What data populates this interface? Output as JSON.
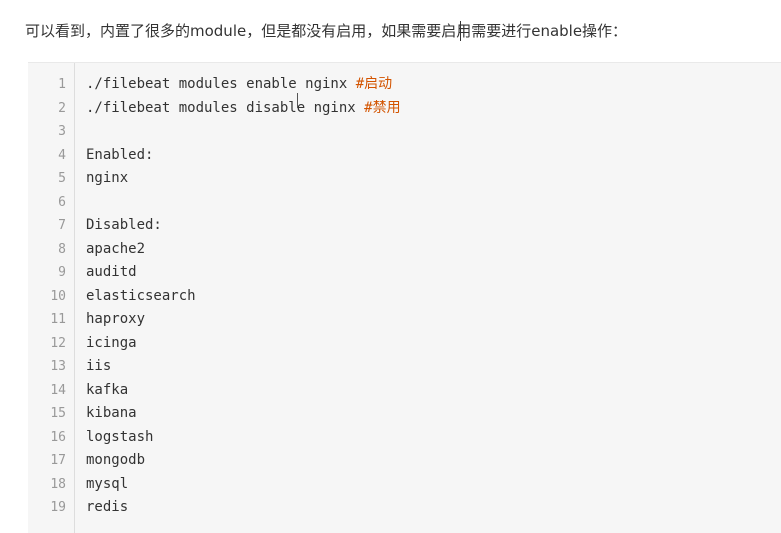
{
  "intro_text": "可以看到，内置了很多的module，但是都没有启用，如果需要启用需要进行enable操作：",
  "code": {
    "lines": [
      {
        "num": "1",
        "text": "./filebeat modules enable nginx ",
        "comment": "#启动"
      },
      {
        "num": "2",
        "text": "./filebeat modules disable nginx ",
        "comment": "#禁用"
      },
      {
        "num": "3",
        "text": "",
        "comment": ""
      },
      {
        "num": "4",
        "text": "Enabled:",
        "comment": ""
      },
      {
        "num": "5",
        "text": "nginx",
        "comment": ""
      },
      {
        "num": "6",
        "text": "",
        "comment": ""
      },
      {
        "num": "7",
        "text": "Disabled:",
        "comment": ""
      },
      {
        "num": "8",
        "text": "apache2",
        "comment": ""
      },
      {
        "num": "9",
        "text": "auditd",
        "comment": ""
      },
      {
        "num": "10",
        "text": "elasticsearch",
        "comment": ""
      },
      {
        "num": "11",
        "text": "haproxy",
        "comment": ""
      },
      {
        "num": "12",
        "text": "icinga",
        "comment": ""
      },
      {
        "num": "13",
        "text": "iis",
        "comment": ""
      },
      {
        "num": "14",
        "text": "kafka",
        "comment": ""
      },
      {
        "num": "15",
        "text": "kibana",
        "comment": ""
      },
      {
        "num": "16",
        "text": "logstash",
        "comment": ""
      },
      {
        "num": "17",
        "text": "mongodb",
        "comment": ""
      },
      {
        "num": "18",
        "text": "mysql",
        "comment": ""
      },
      {
        "num": "19",
        "text": "redis",
        "comment": ""
      }
    ]
  },
  "colors": {
    "comment": "#d35400",
    "line_number": "#999999",
    "code_background": "#f6f6f6"
  }
}
